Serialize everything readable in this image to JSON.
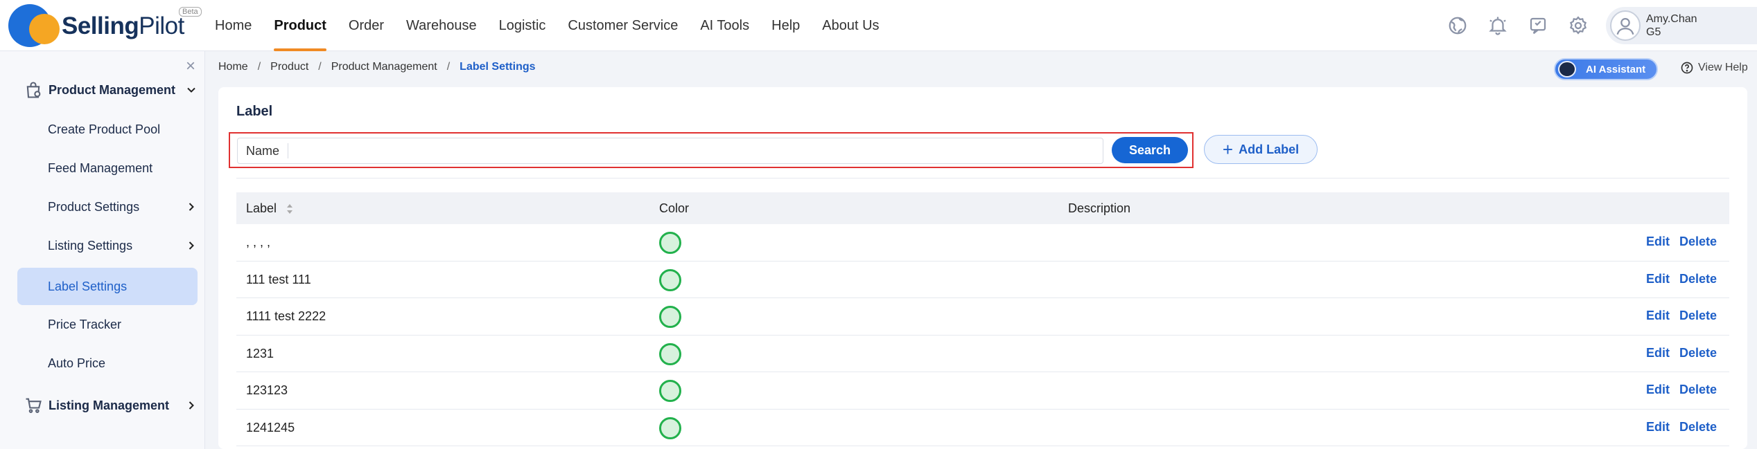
{
  "brand": {
    "name_bold": "Selling",
    "name_light": "Pilot",
    "badge": "Beta"
  },
  "nav": [
    {
      "label": "Home",
      "active": false
    },
    {
      "label": "Product",
      "active": true
    },
    {
      "label": "Order",
      "active": false
    },
    {
      "label": "Warehouse",
      "active": false
    },
    {
      "label": "Logistic",
      "active": false
    },
    {
      "label": "Customer Service",
      "active": false
    },
    {
      "label": "AI Tools",
      "active": false
    },
    {
      "label": "Help",
      "active": false
    },
    {
      "label": "About Us",
      "active": false
    }
  ],
  "top_icons": [
    "globe-icon",
    "bell-icon",
    "feedback-icon",
    "gear-icon"
  ],
  "user": {
    "name": "Amy.Chan",
    "group": "G5"
  },
  "sidebar": {
    "close": "×",
    "group_product": "Product Management",
    "items": [
      {
        "label": "Create Product Pool"
      },
      {
        "label": "Feed Management"
      },
      {
        "label": "Product Settings"
      },
      {
        "label": "Listing Settings"
      },
      {
        "label": "Label Settings"
      },
      {
        "label": "Price Tracker"
      },
      {
        "label": "Auto Price"
      }
    ],
    "group_listing": "Listing Management"
  },
  "breadcrumb": [
    "Home",
    "Product",
    "Product Management",
    "Label Settings"
  ],
  "ai_assistant": "AI Assistant",
  "view_help": "View Help",
  "card": {
    "title": "Label",
    "search": {
      "field_label": "Name",
      "value": "",
      "placeholder": "",
      "button": "Search"
    },
    "add_button": "Add Label"
  },
  "table": {
    "headers": [
      "Label",
      "Color",
      "Description"
    ],
    "action_edit": "Edit",
    "action_delete": "Delete",
    "rows": [
      {
        "label": ", , , ,",
        "color": "#22b14c",
        "description": ""
      },
      {
        "label": "111 test 111",
        "color": "#22b14c",
        "description": ""
      },
      {
        "label": "1111 test 2222",
        "color": "#22b14c",
        "description": ""
      },
      {
        "label": "1231",
        "color": "#22b14c",
        "description": ""
      },
      {
        "label": "123123",
        "color": "#22b14c",
        "description": ""
      },
      {
        "label": "1241245",
        "color": "#22b14c",
        "description": ""
      }
    ]
  },
  "colors": {
    "accent": "#1666d4",
    "nav_active_underline": "#f08a24",
    "highlight": "#e03131"
  }
}
